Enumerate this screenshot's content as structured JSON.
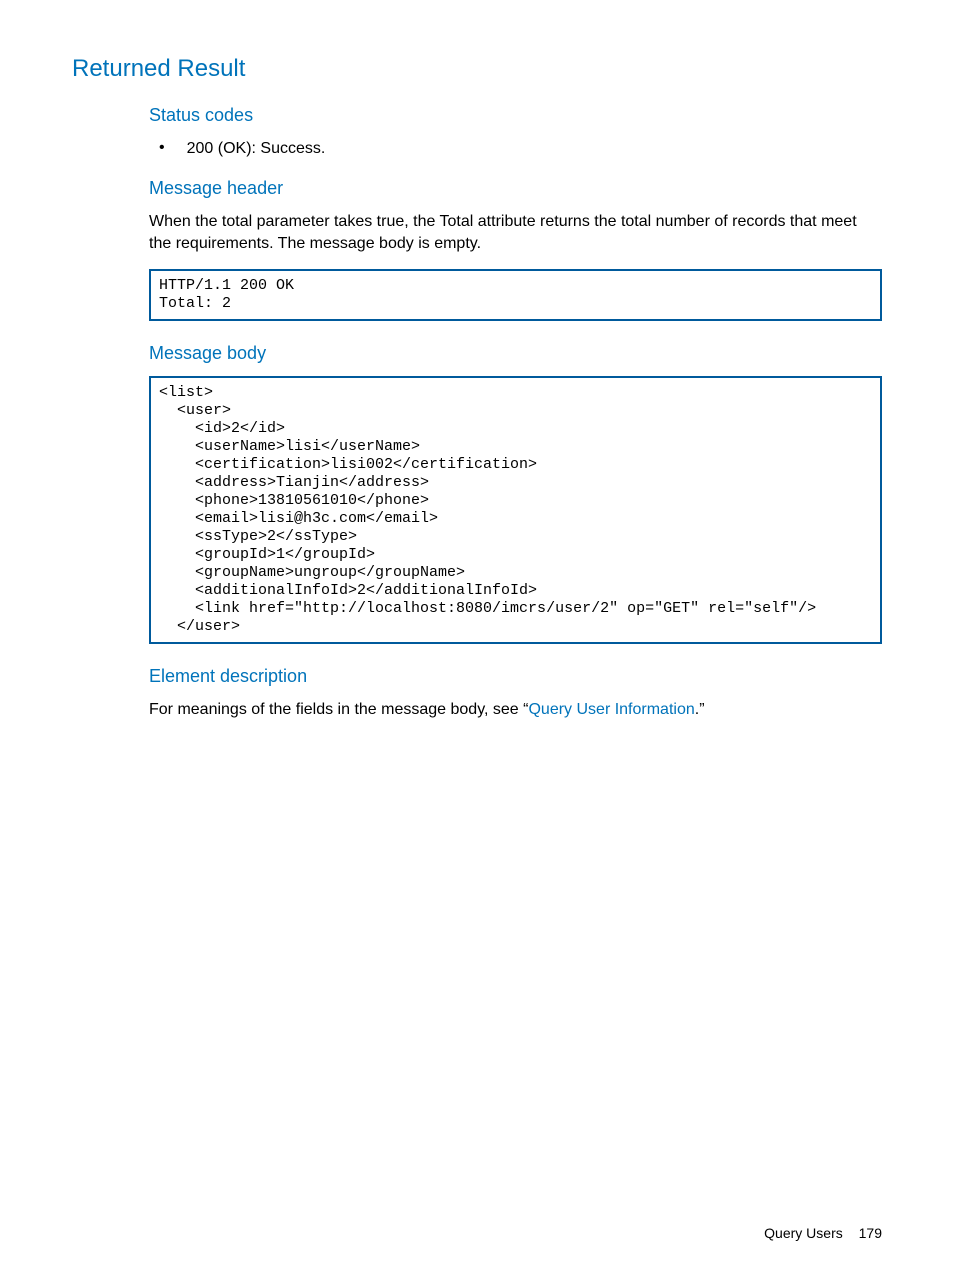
{
  "headings": {
    "returned_result": "Returned Result",
    "status_codes": "Status codes",
    "message_header": "Message header",
    "message_body": "Message body",
    "element_description": "Element description"
  },
  "status_code_item": "200 (OK): Success.",
  "message_header_para": "When the total parameter takes true, the Total attribute returns the total number of records that meet the requirements. The message body is empty.",
  "code_header": "HTTP/1.1 200 OK\nTotal: 2",
  "code_body": "<list>\n  <user>\n    <id>2</id>\n    <userName>lisi</userName>\n    <certification>lisi002</certification>\n    <address>Tianjin</address>\n    <phone>13810561010</phone>\n    <email>lisi@h3c.com</email>\n    <ssType>2</ssType>\n    <groupId>1</groupId>\n    <groupName>ungroup</groupName>\n    <additionalInfoId>2</additionalInfoId>\n    <link href=\"http://localhost:8080/imcrs/user/2\" op=\"GET\" rel=\"self\"/>\n  </user>",
  "element_desc": {
    "prefix": "For meanings of the fields in the message body, see “",
    "link": "Query User Information",
    "suffix": ".”"
  },
  "footer": {
    "title": "Query Users",
    "page": "179"
  }
}
